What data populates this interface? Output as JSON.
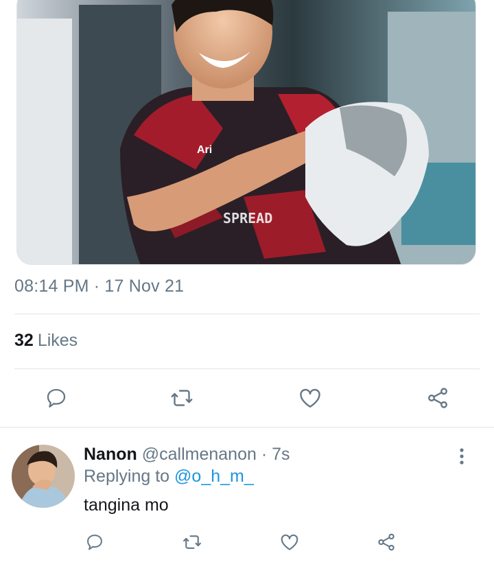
{
  "tweet": {
    "photo_print": {
      "brand": "Ari",
      "word": "SPREAD"
    },
    "timestamp": "08:14 PM · 17 Nov 21",
    "likes_count": "32",
    "likes_label": "Likes",
    "actions": [
      "reply-icon",
      "retweet-icon",
      "like-icon",
      "share-icon"
    ]
  },
  "reply": {
    "name": "Nanon",
    "handle": "@callmenanon",
    "separator": "·",
    "time": "7s",
    "replying_to_label": "Replying to",
    "replying_to_handle": "@o_h_m_",
    "text": "tangina mo",
    "actions": [
      "reply-icon",
      "retweet-icon",
      "like-icon",
      "share-icon"
    ],
    "more_icon": "more-vertical-icon"
  },
  "colors": {
    "secondary_text": "#657786",
    "link": "#1b95e0",
    "divider": "#dfe3e6",
    "icon": "#657786"
  }
}
